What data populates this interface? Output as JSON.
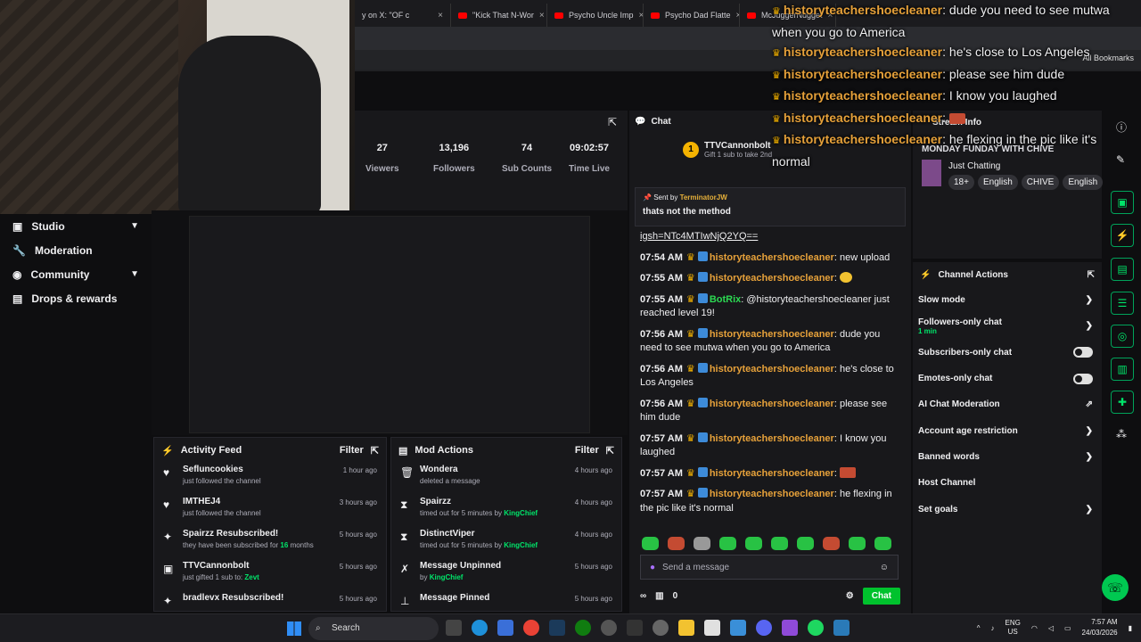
{
  "browser": {
    "tabs": [
      {
        "label": "y on X: \"OF c",
        "yt": false
      },
      {
        "label": "\"Kick That N-Wor",
        "yt": true
      },
      {
        "label": "Psycho Uncle Imp",
        "yt": true
      },
      {
        "label": "Psycho Dad Flatte",
        "yt": true
      },
      {
        "label": "McJuggerNugget",
        "yt": true
      }
    ],
    "all_bookmarks": "All Bookmarks"
  },
  "sidebar": {
    "items": [
      {
        "label": "Studio",
        "icon": "studio-icon",
        "chevron": true
      },
      {
        "label": "Moderation",
        "icon": "wrench-icon",
        "chevron": false
      },
      {
        "label": "Community",
        "icon": "community-icon",
        "chevron": true
      },
      {
        "label": "Drops & rewards",
        "icon": "gift-icon",
        "chevron": false
      }
    ]
  },
  "stats": [
    {
      "value": "27",
      "label": "Viewers"
    },
    {
      "value": "13,196",
      "label": "Followers"
    },
    {
      "value": "74",
      "label": "Sub Counts"
    },
    {
      "value": "09:02:57",
      "label": "Time Live"
    }
  ],
  "activity_feed": {
    "title": "Activity Feed",
    "filter": "Filter",
    "rows": [
      {
        "icon": "heart-icon",
        "name": "Sefluncookies",
        "detail": "just followed the channel",
        "time": "1 hour ago"
      },
      {
        "icon": "heart-icon",
        "name": "IMTHEJ4",
        "detail": "just followed the channel",
        "time": "3 hours ago"
      },
      {
        "icon": "star-icon",
        "name": "Spairzz Resubscribed!",
        "detail": "they have been subscribed for",
        "extra": "16",
        "extra2": "months",
        "time": "5 hours ago"
      },
      {
        "icon": "gift-icon",
        "name": "TTVCannonbolt",
        "detail": "just gifted 1 sub to:",
        "extra": "Zevt",
        "time": "5 hours ago"
      },
      {
        "icon": "star-icon",
        "name": "bradlevx Resubscribed!",
        "detail": "",
        "time": "5 hours ago"
      }
    ]
  },
  "mod_actions": {
    "title": "Mod Actions",
    "filter": "Filter",
    "rows": [
      {
        "icon": "trash-icon",
        "name": "Wondera",
        "detail": "deleted a message",
        "time": "4 hours ago"
      },
      {
        "icon": "hourglass-icon",
        "name": "Spairzz",
        "detail": "timed out for 5 minutes by",
        "extra": "KingChief",
        "time": "4 hours ago"
      },
      {
        "icon": "hourglass-icon",
        "name": "DistinctViper",
        "detail": "timed out for 5 minutes by",
        "extra": "KingChief",
        "time": "4 hours ago"
      },
      {
        "icon": "unpin-icon",
        "name": "Message Unpinned",
        "detail": "by",
        "extra": "KingChief",
        "time": "5 hours ago"
      },
      {
        "icon": "pin-icon",
        "name": "Message Pinned",
        "detail": "",
        "time": "5 hours ago"
      }
    ]
  },
  "chat": {
    "title": "Chat",
    "gift_user": "TTVCannonbolt",
    "gift_count": "1",
    "gift_text": "Gift 1 sub to take 2nd",
    "pinned_by_label": "Sent by",
    "pinned_by": "TerminatorJW",
    "pinned_msg": "thats not the method",
    "link_fragment": "igsh=NTc4MTIwNjQ2YQ==",
    "messages": [
      {
        "time": "07:54 AM",
        "user": "historyteachershoecleaner",
        "text": "new upload",
        "bot": false,
        "emote": ""
      },
      {
        "time": "07:55 AM",
        "user": "historyteachershoecleaner",
        "text": "",
        "bot": false,
        "emote": "yellow"
      },
      {
        "time": "07:55 AM",
        "user": "BotRix",
        "text": "@historyteachershoecleaner just reached level 19!",
        "bot": true,
        "emote": ""
      },
      {
        "time": "07:56 AM",
        "user": "historyteachershoecleaner",
        "text": "dude you need to see mutwa when you go to America",
        "bot": false,
        "emote": ""
      },
      {
        "time": "07:56 AM",
        "user": "historyteachershoecleaner",
        "text": "he's close to Los Angeles",
        "bot": false,
        "emote": ""
      },
      {
        "time": "07:56 AM",
        "user": "historyteachershoecleaner",
        "text": "please see him dude",
        "bot": false,
        "emote": ""
      },
      {
        "time": "07:57 AM",
        "user": "historyteachershoecleaner",
        "text": "I know you laughed",
        "bot": false,
        "emote": ""
      },
      {
        "time": "07:57 AM",
        "user": "historyteachershoecleaner",
        "text": "",
        "bot": false,
        "emote": "red"
      },
      {
        "time": "07:57 AM",
        "user": "historyteachershoecleaner",
        "text": "he flexing in the pic like it's normal",
        "bot": false,
        "emote": ""
      }
    ],
    "input_placeholder": "Send a message",
    "points": "0",
    "send_label": "Chat"
  },
  "stream_info": {
    "header": "Stream Info",
    "title": "MONDAY FUNDAY WITH CHIVE",
    "category": "Just Chatting",
    "tags": [
      "18+",
      "English",
      "CHIVE",
      "English"
    ]
  },
  "channel_actions": {
    "title": "Channel Actions",
    "rows": [
      {
        "label": "Slow mode",
        "sub": "",
        "control": "chevron"
      },
      {
        "label": "Followers-only chat",
        "sub": "1 min",
        "control": "chevron"
      },
      {
        "label": "Subscribers-only chat",
        "sub": "",
        "control": "toggle"
      },
      {
        "label": "Emotes-only chat",
        "sub": "",
        "control": "toggle"
      },
      {
        "label": "AI Chat Moderation",
        "sub": "",
        "control": "external"
      },
      {
        "label": "Account age restriction",
        "sub": "",
        "control": "chevron"
      },
      {
        "label": "Banned words",
        "sub": "",
        "control": "chevron"
      },
      {
        "label": "Host Channel",
        "sub": "",
        "control": "none"
      },
      {
        "label": "Set goals",
        "sub": "",
        "control": "chevron"
      }
    ]
  },
  "overlay": [
    {
      "user": "historyteachershoecleaner",
      "text": "dude you need to see mutwa"
    },
    {
      "user": "",
      "text": "when you go to America"
    },
    {
      "user": "historyteachershoecleaner",
      "text": "he's close to Los Angeles"
    },
    {
      "user": "historyteachershoecleaner",
      "text": "please see him dude"
    },
    {
      "user": "historyteachershoecleaner",
      "text": "I know you laughed"
    },
    {
      "user": "historyteachershoecleaner",
      "text": ""
    },
    {
      "user": "historyteachershoecleaner",
      "text": "he flexing in the pic like it's"
    },
    {
      "user": "",
      "text": "normal"
    }
  ],
  "taskbar": {
    "search": "Search",
    "lang": "ENG",
    "region": "US",
    "time": "7:57 AM",
    "date": "24/03/2026"
  },
  "colors": {
    "accent": "#00c22d",
    "username": "#e6a13a",
    "bot": "#2cd952"
  }
}
